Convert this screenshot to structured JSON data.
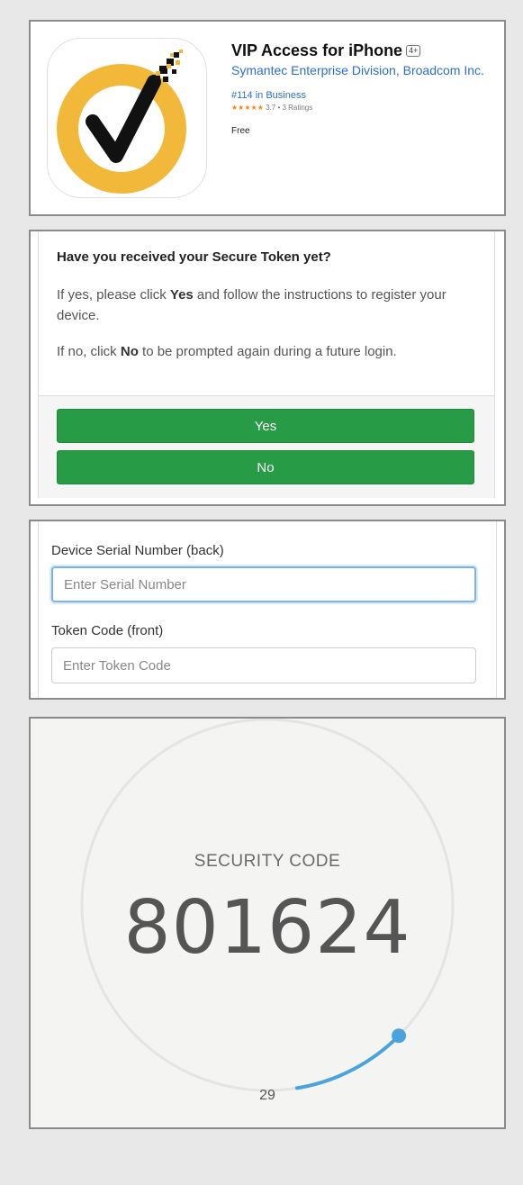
{
  "app_store": {
    "title": "VIP Access for iPhone",
    "age_rating": "4+",
    "developer": "Symantec Enterprise Division, Broadcom Inc.",
    "rank": "#114 in Business",
    "stars": "★★★★★",
    "rating_text": "3.7 • 3 Ratings",
    "rating_value": 3.7,
    "price": "Free",
    "icon_colors": {
      "ring": "#f2b83a",
      "check": "#111111",
      "accent": "#f2b83a"
    }
  },
  "token_prompt": {
    "question": "Have you received your Secure Token yet?",
    "para1_prefix": "If yes, please click ",
    "para1_bold": "Yes",
    "para1_suffix": " and follow the instructions to register your device.",
    "para2_prefix": "If no, click ",
    "para2_bold": "No",
    "para2_suffix": " to be prompted again during a future login.",
    "yes_label": "Yes",
    "no_label": "No",
    "button_color": "#279b46"
  },
  "device_form": {
    "serial_label": "Device Serial Number (back)",
    "serial_placeholder": "Enter Serial Number",
    "serial_value": "",
    "token_label": "Token Code (front)",
    "token_placeholder": "Enter Token Code",
    "token_value": ""
  },
  "security": {
    "label": "SECURITY CODE",
    "code": "801624",
    "seconds_remaining": "29",
    "progress_fraction": 0.1,
    "progress_color": "#4aa3dc"
  }
}
